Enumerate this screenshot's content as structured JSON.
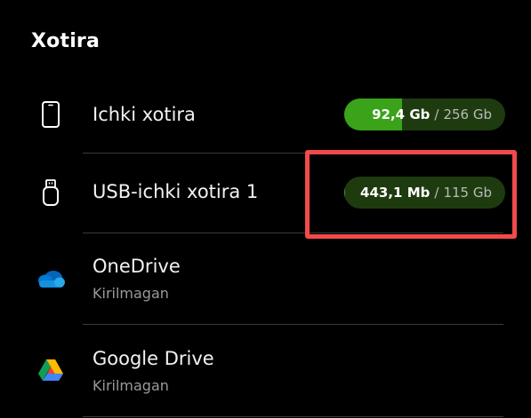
{
  "header": {
    "title": "Xotira"
  },
  "storage": {
    "internal": {
      "label": "Ichki xotira",
      "icon": "phone-icon",
      "used": "92,4 Gb",
      "separator": "/",
      "total": "256 Gb",
      "used_fraction": 0.36
    },
    "usb": {
      "label": "USB-ichki xotira 1",
      "icon": "usb-drive-icon",
      "used": "443,1 Mb",
      "separator": "/",
      "total": "115 Gb",
      "used_fraction": 0.004
    }
  },
  "cloud": {
    "onedrive": {
      "label": "OneDrive",
      "status": "Kirilmagan",
      "icon": "onedrive-cloud-icon"
    },
    "google_drive": {
      "label": "Google Drive",
      "status": "Kirilmagan",
      "icon": "google-drive-icon"
    }
  },
  "colors": {
    "background": "#000000",
    "usage_fill": "#3aa31a",
    "usage_track": "#1e3b0f",
    "highlight": "#f24a4a",
    "subtitle": "#9a9a9a"
  }
}
